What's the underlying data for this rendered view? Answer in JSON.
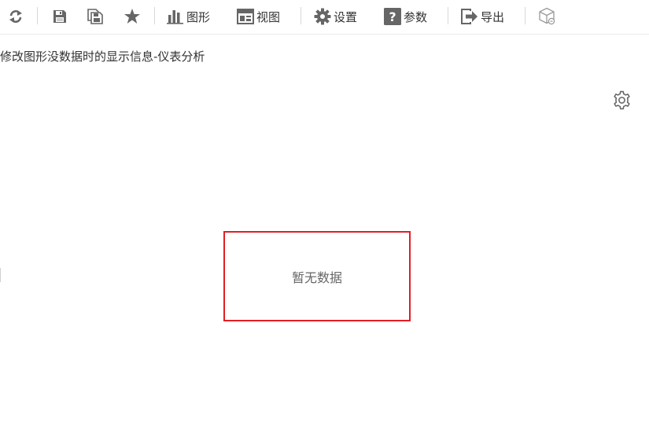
{
  "toolbar": {
    "items": [
      {
        "icon": "refresh-icon",
        "label": ""
      },
      {
        "icon": "save-icon",
        "label": ""
      },
      {
        "icon": "save-as-icon",
        "label": ""
      },
      {
        "icon": "star-icon",
        "label": ""
      },
      {
        "icon": "bar-chart-icon",
        "label": "图形"
      },
      {
        "icon": "view-icon",
        "label": "视图"
      },
      {
        "icon": "gear-icon",
        "label": "设置"
      },
      {
        "icon": "question-icon",
        "label": "参数"
      },
      {
        "icon": "export-icon",
        "label": "导出"
      },
      {
        "icon": "cube-icon",
        "label": ""
      }
    ]
  },
  "report": {
    "title": "修改图形没数据时的显示信息-仪表分析"
  },
  "chart_panel": {
    "settings_icon": "gear-outline-icon",
    "empty_message": "暂无数据",
    "highlight_color": "#e31e24"
  }
}
